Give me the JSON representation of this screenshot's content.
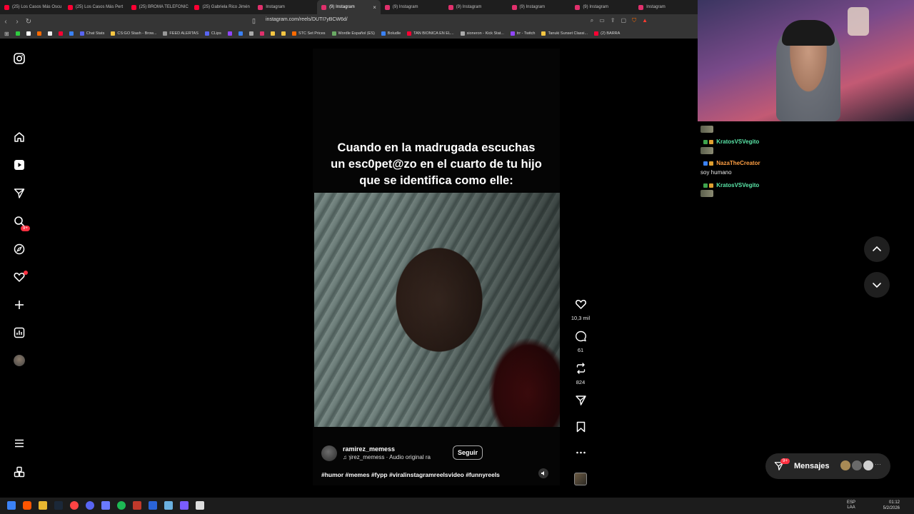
{
  "browser": {
    "tabs": [
      {
        "label": "(25) Los Casos Más Oscu",
        "color": "#ff0033"
      },
      {
        "label": "(25) Los Casos Más Pert",
        "color": "#ff0033"
      },
      {
        "label": "(25) BROMA TELEFONIC",
        "color": "#ff0033"
      },
      {
        "label": "(25) Gabriela Rico Jimén",
        "color": "#ff0033"
      },
      {
        "label": "Instagram",
        "color": "#e1306c"
      },
      {
        "label": "(9) Instagram",
        "color": "#e1306c",
        "active": true,
        "close": "×"
      },
      {
        "label": "(9) Instagram",
        "color": "#e1306c"
      },
      {
        "label": "(9) Instagram",
        "color": "#e1306c"
      },
      {
        "label": "(9) Instagram",
        "color": "#e1306c"
      },
      {
        "label": "(9) Instagram",
        "color": "#e1306c"
      },
      {
        "label": "Instagram",
        "color": "#e1306c"
      }
    ],
    "url": "instagram.com/reels/DUTI7yBCW6d/",
    "bookmarks": [
      {
        "label": "",
        "color": "#2ecc40"
      },
      {
        "label": "",
        "color": "#ffffff"
      },
      {
        "label": "",
        "color": "#ff6a00"
      },
      {
        "label": "",
        "color": "#eeeeee"
      },
      {
        "label": "",
        "color": "#ff0033"
      },
      {
        "label": "",
        "color": "#3b82f6"
      },
      {
        "label": "Chat Stats",
        "color": "#5865f2"
      },
      {
        "label": "CS:GO Stash - Brow...",
        "color": "#f5c542"
      },
      {
        "label": "FEED ALERTAS",
        "color": "#999999"
      },
      {
        "label": "CLips",
        "color": "#5865f2"
      },
      {
        "label": "",
        "color": "#9146ff"
      },
      {
        "label": "",
        "color": "#3b82f6"
      },
      {
        "label": "",
        "color": "#aaaaaa"
      },
      {
        "label": "",
        "color": "#e1306c"
      },
      {
        "label": "",
        "color": "#f5c542"
      },
      {
        "label": "",
        "color": "#f5c542"
      },
      {
        "label": "STC Set Prices",
        "color": "#ff6a00"
      },
      {
        "label": "Wordle Español (ES)",
        "color": "#6aaa64"
      },
      {
        "label": "Boludle",
        "color": "#3b82f6"
      },
      {
        "label": "TAN BIONICA EN EL...",
        "color": "#ff0033"
      },
      {
        "label": "sioneron - Kick Stat...",
        "color": "#aaaaaa"
      },
      {
        "label": "trr - Twitch",
        "color": "#9146ff"
      },
      {
        "label": "Tanuki Sunset Classi...",
        "color": "#f5c542"
      },
      {
        "label": "(2) BARRA",
        "color": "#ff0033"
      }
    ]
  },
  "instagram": {
    "nav_badge": "9+",
    "reel": {
      "caption_lines": [
        "Cuando en la madrugada escuchas",
        "un esc0pet@zo en el cuarto de tu hijo",
        "que se identifica como elle:"
      ],
      "username": "ramirez_memess",
      "audio": "♫ ɿirez_memess · Audio original   ra",
      "follow_label": "Seguir",
      "hashtags": "#humor #memes #fypp #viralinstagramreelsvideo #funnyreels"
    },
    "actions": {
      "likes": "10,3 mil",
      "comments": "61",
      "reposts": "824"
    },
    "messages": {
      "label": "Mensajes",
      "badge": "9+"
    }
  },
  "stream_chat": [
    {
      "user": "KratosVSVegito",
      "text": "",
      "color": "#5ae6a8"
    },
    {
      "user": "NazaTheCreator",
      "text": "soy humano",
      "color": "#ff9f43"
    },
    {
      "user": "KratosVSVegito",
      "text": "",
      "color": "#5ae6a8"
    }
  ],
  "taskbar": {
    "lang_top": "ESP",
    "lang_bottom": "LAA",
    "time": "01:12",
    "date": "5/2/2026"
  }
}
